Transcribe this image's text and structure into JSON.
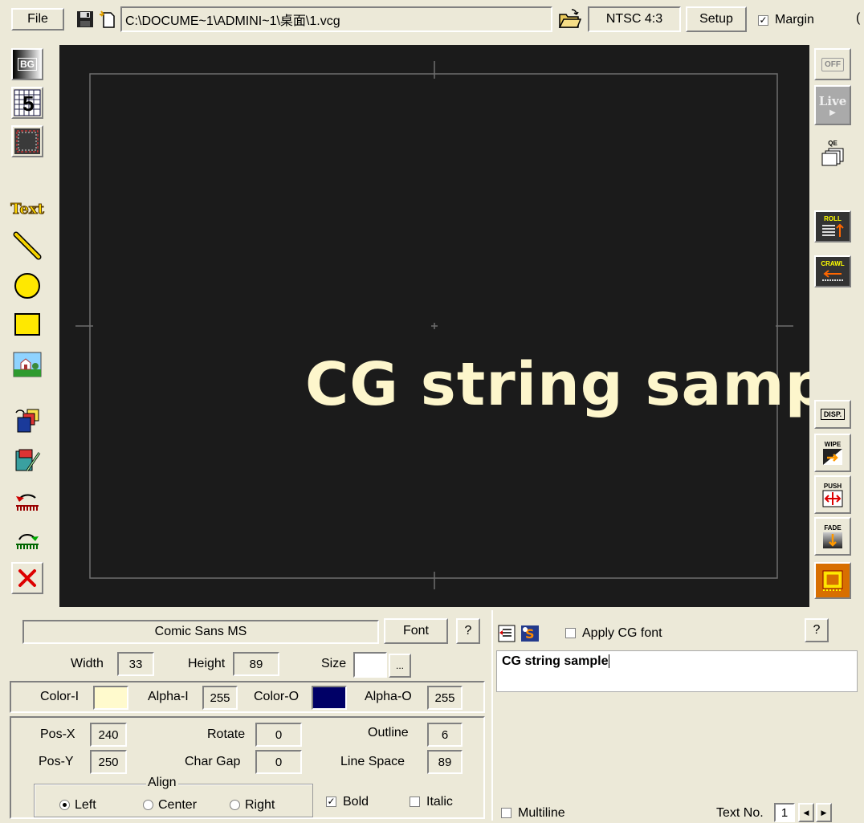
{
  "top": {
    "file_label": "File",
    "path": "C:\\DOCUME~1\\ADMINI~1\\桌面\\1.vcg",
    "format": "NTSC 4:3",
    "setup_label": "Setup",
    "margin_label": "Margin",
    "margin_checked": true
  },
  "left_tools": {
    "bg_label": "BG",
    "grid_label": "5",
    "text_label": "Text"
  },
  "right_tools": {
    "off_label": "OFF",
    "live_label": "Live",
    "qe_label": "QE",
    "roll_label": "ROLL",
    "crawl_label": "CRAWL",
    "disp_label": "DISP.",
    "wipe_label": "WIPE",
    "push_label": "PUSH",
    "fade_label": "FADE"
  },
  "canvas": {
    "cg_text": "CG string samp",
    "text_color": "#fdf6cc",
    "bg_color": "#1b1b1b"
  },
  "font_panel": {
    "font_name": "Comic Sans MS",
    "font_button": "Font",
    "help_label": "?",
    "width_label": "Width",
    "width_value": "33",
    "height_label": "Height",
    "height_value": "89",
    "size_label": "Size",
    "size_button": "...",
    "color_i_label": "Color-I",
    "color_i": "#fffacd",
    "alpha_i_label": "Alpha-I",
    "alpha_i_value": "255",
    "color_o_label": "Color-O",
    "color_o": "#000066",
    "alpha_o_label": "Alpha-O",
    "alpha_o_value": "255",
    "posx_label": "Pos-X",
    "posx_value": "240",
    "posy_label": "Pos-Y",
    "posy_value": "250",
    "rotate_label": "Rotate",
    "rotate_value": "0",
    "chargap_label": "Char Gap",
    "chargap_value": "0",
    "outline_label": "Outline",
    "outline_value": "6",
    "linespace_label": "Line Space",
    "linespace_value": "89",
    "align_label": "Align",
    "align_left": "Left",
    "align_center": "Center",
    "align_right": "Right",
    "align_selected": "Left",
    "bold_label": "Bold",
    "bold_checked": true,
    "italic_label": "Italic",
    "italic_checked": false
  },
  "text_panel": {
    "apply_cg_font_label": "Apply CG font",
    "help_label": "?",
    "text_value": "CG string sample",
    "multiline_label": "Multiline",
    "text_no_label": "Text No.",
    "text_no_value": "1"
  }
}
